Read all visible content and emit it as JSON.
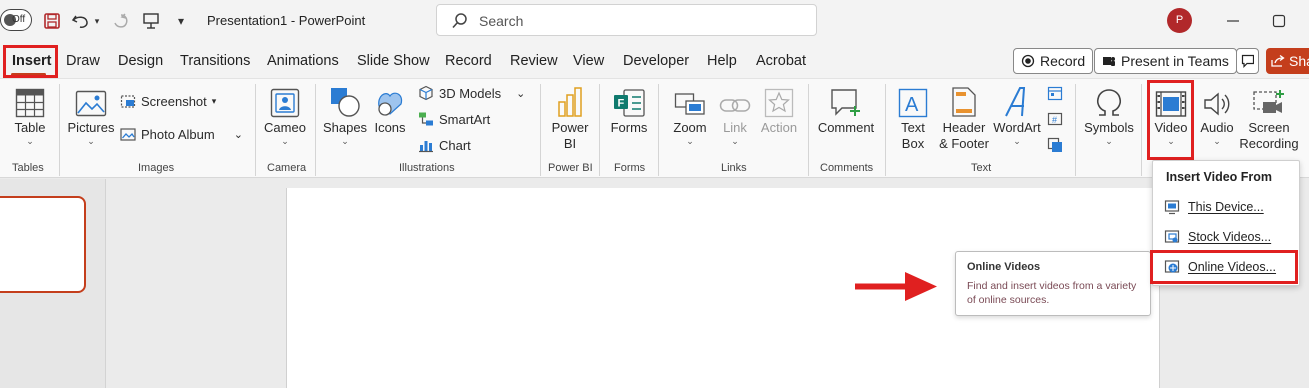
{
  "titlebar": {
    "autosave_state": "Off",
    "doc_title": "Presentation1  -  PowerPoint",
    "search_placeholder": "Search",
    "avatar_initial": "P"
  },
  "tabs": [
    "Insert",
    "Draw",
    "Design",
    "Transitions",
    "Animations",
    "Slide Show",
    "Record",
    "Review",
    "View",
    "Developer",
    "Help",
    "Acrobat"
  ],
  "tab_actions": {
    "record": "Record",
    "present_in_teams": "Present in Teams",
    "share": "Sha"
  },
  "ribbon": {
    "table": "Table",
    "pictures": "Pictures",
    "screenshot": "Screenshot",
    "photo_album": "Photo Album",
    "cameo": "Cameo",
    "shapes": "Shapes",
    "icons": "Icons",
    "models_3d": "3D Models",
    "smartart": "SmartArt",
    "chart": "Chart",
    "power_bi_line1": "Power",
    "power_bi_line2": "BI",
    "forms": "Forms",
    "zoom": "Zoom",
    "link": "Link",
    "action": "Action",
    "comment": "Comment",
    "text_box_line1": "Text",
    "text_box_line2": "Box",
    "header_footer_line1": "Header",
    "header_footer_line2": "& Footer",
    "wordart": "WordArt",
    "symbols": "Symbols",
    "video": "Video",
    "audio": "Audio",
    "screen_recording_line1": "Screen",
    "screen_recording_line2": "Recording"
  },
  "groups": {
    "tables": "Tables",
    "images": "Images",
    "camera": "Camera",
    "illustrations": "Illustrations",
    "power_bi": "Power BI",
    "forms": "Forms",
    "links": "Links",
    "comments": "Comments",
    "text": "Text"
  },
  "video_menu": {
    "header": "Insert Video From",
    "items": [
      "This Device...",
      "Stock Videos...",
      "Online Videos..."
    ]
  },
  "tooltip": {
    "title": "Online Videos",
    "description": "Find and insert videos from a variety of online sources."
  },
  "colors": {
    "accent": "#c43e1c",
    "highlight_box": "#e02020",
    "tooltip_text": "#7a4a55"
  }
}
